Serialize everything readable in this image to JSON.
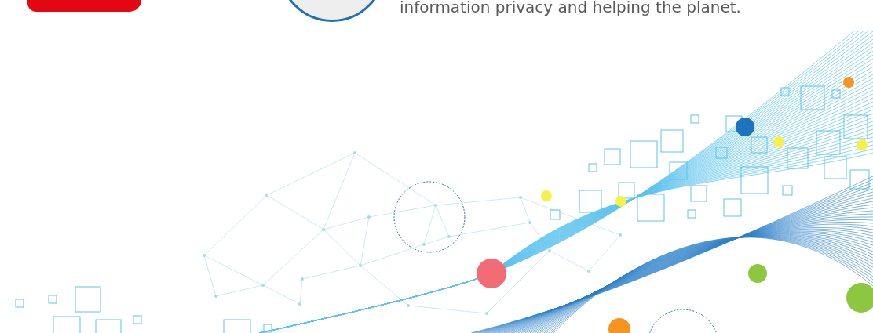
{
  "intro": {
    "text": "information privacy and helping the planet."
  }
}
